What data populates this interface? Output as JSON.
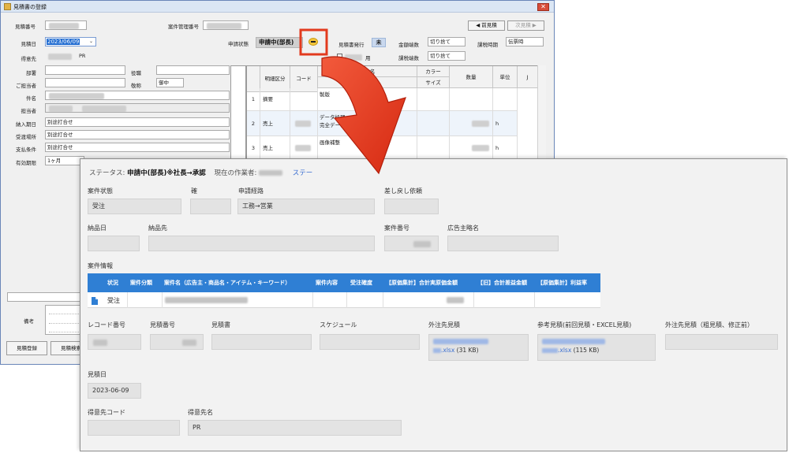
{
  "window1": {
    "title": "見積書の登録",
    "close_glyph": "✕",
    "labels": {
      "quote_no": "見積番号",
      "case_mgmt_no": "案件管理番号",
      "quote_date": "見積日",
      "customer": "得意先",
      "department": "部署",
      "person_in_charge": "ご担当者",
      "subject": "件名",
      "staff": "担当者",
      "delivery_date": "納入期日",
      "delivery_place": "受渡場所",
      "payment_terms": "支払条件",
      "valid_period": "有効期限",
      "title_role": "役職",
      "honorific": "敬称",
      "application_status": "申請状態",
      "quote_issue": "見積書発行",
      "amount_rounding": "金額端数",
      "tax_rounding": "課税端数",
      "tax_timing": "課税時期",
      "yen_suffix": "用",
      "remarks": "備考"
    },
    "values": {
      "quote_date": "2023/06/09",
      "customer_suffix": "PR",
      "honorific": "御中",
      "delivery_date": "別途打合せ",
      "delivery_place": "別途打合せ",
      "payment_terms": "別途打合せ",
      "valid_period": "1ヶ月",
      "application_status": "申請中(部長)",
      "quote_issue": "未",
      "amount_rounding": "切り捨て",
      "tax_rounding": "切り捨て",
      "tax_timing": "伝票時"
    },
    "buttons": {
      "prev_quote": "◀ 前見積",
      "next_quote": "次見積 ▶",
      "register": "見積登録",
      "search": "見積検索"
    },
    "grid": {
      "headers": {
        "detail_type": "明細区分",
        "code": "コード",
        "product_name": "商品名",
        "spec": "規格",
        "color": "カラー",
        "size": "サイズ",
        "quantity": "数量",
        "unit": "単位",
        "extra": "J"
      },
      "rows": [
        {
          "no": "1",
          "type": "摘要",
          "name_line1": "製版",
          "name_line2": "",
          "unit": ""
        },
        {
          "no": "2",
          "type": "売上",
          "name_line1": "データ処理",
          "name_line2": "完全データ・確認、データUP",
          "unit": "h"
        },
        {
          "no": "3",
          "type": "売上",
          "name_line1": "画像補整",
          "name_line2": "",
          "unit": "h"
        }
      ]
    }
  },
  "window2": {
    "status_prefix": "ステータス:",
    "status_value": "申請中(部長)※社長→承認",
    "current_worker_label": "現在の作業者:",
    "status_link": "ステー",
    "fields": {
      "case_status_label": "案件状態",
      "case_status_value": "受注",
      "kakudo_label": "確",
      "route_label": "申請経路",
      "route_value": "工務→営業",
      "sendback_label": "差し戻し依頼",
      "delivery_date_label": "納品日",
      "delivery_to_label": "納品先",
      "case_no_label": "案件番号",
      "ad_short_label": "広告主略名",
      "case_info_label": "案件情報",
      "record_no_label": "レコード番号",
      "quote_no_label": "見積番号",
      "quote_doc_label": "見積書",
      "schedule_label": "スケジュール",
      "outsourced_label": "外注先見積",
      "reference_label": "参考見積(前回見積・EXCEL見積)",
      "outsourced2_label": "外注先見積（粗見積、修正前）",
      "quote_date_label": "見積日",
      "quote_date_value": "2023-06-09",
      "customer_code_label": "得意先コード",
      "customer_name_label": "得意先名",
      "customer_name_value": "PR"
    },
    "attachments": [
      {
        "ext": ".xlsx",
        "size": "(31 KB)"
      },
      {
        "ext": ".xlsx",
        "size": "(115 KB)"
      }
    ],
    "table": {
      "headers": [
        "状況",
        "案件分類",
        "案件名（広告主・商品名・アイテム・キーワード）",
        "案件内容",
        "受注確度",
        "【原価集計】合計実原価金額",
        "【旧】合計差益金額",
        "【原価集計】利益率"
      ],
      "row": {
        "status": "受注"
      }
    }
  },
  "colors": {
    "accent_blue": "#2f7fd4",
    "highlight_red": "#e23a1e",
    "link_blue": "#3b6fd1"
  }
}
